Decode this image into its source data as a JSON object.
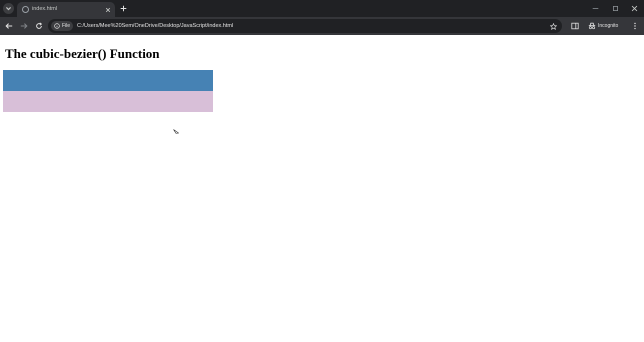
{
  "browser": {
    "tab": {
      "title": "index.html"
    },
    "address": {
      "chip_label": "File",
      "url": "C:/Users/Mee%20Sem/OneDrive/Desktop/JavaScript/index.html"
    },
    "profile": {
      "label": "Incognito"
    }
  },
  "page": {
    "heading": "The cubic-bezier() Function",
    "boxes": [
      {
        "color": "#4682b4"
      },
      {
        "color": "#d8bfd8"
      }
    ]
  }
}
